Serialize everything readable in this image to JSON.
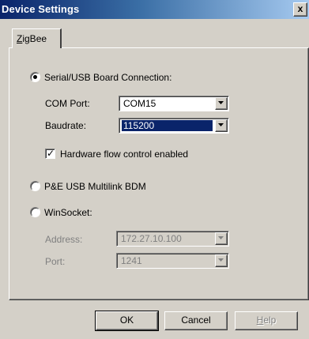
{
  "window": {
    "title": "Device Settings",
    "close_glyph": "x"
  },
  "tabs": [
    {
      "label_accel": "Z",
      "label_rest": "igBee"
    }
  ],
  "connection": {
    "serial": {
      "label": "Serial/USB Board Connection:",
      "selected": true,
      "com_port": {
        "label": "COM Port:",
        "value": "COM15"
      },
      "baudrate": {
        "label": "Baudrate:",
        "value": "115200"
      },
      "flow_control": {
        "label": "Hardware flow control enabled",
        "checked": true
      }
    },
    "pe_usb": {
      "label": "P&E USB Multilink BDM",
      "selected": false
    },
    "winsocket": {
      "label": "WinSocket:",
      "selected": false,
      "address": {
        "label": "Address:",
        "value": "172.27.10.100"
      },
      "port": {
        "label": "Port:",
        "value": "1241"
      }
    }
  },
  "buttons": {
    "ok": "OK",
    "cancel": "Cancel",
    "help_accel": "H",
    "help_rest": "elp"
  },
  "colors": {
    "title_gradient_start": "#0a246a",
    "selection": "#0a246a",
    "face": "#d4d0c8",
    "disabled_text": "#808080"
  }
}
